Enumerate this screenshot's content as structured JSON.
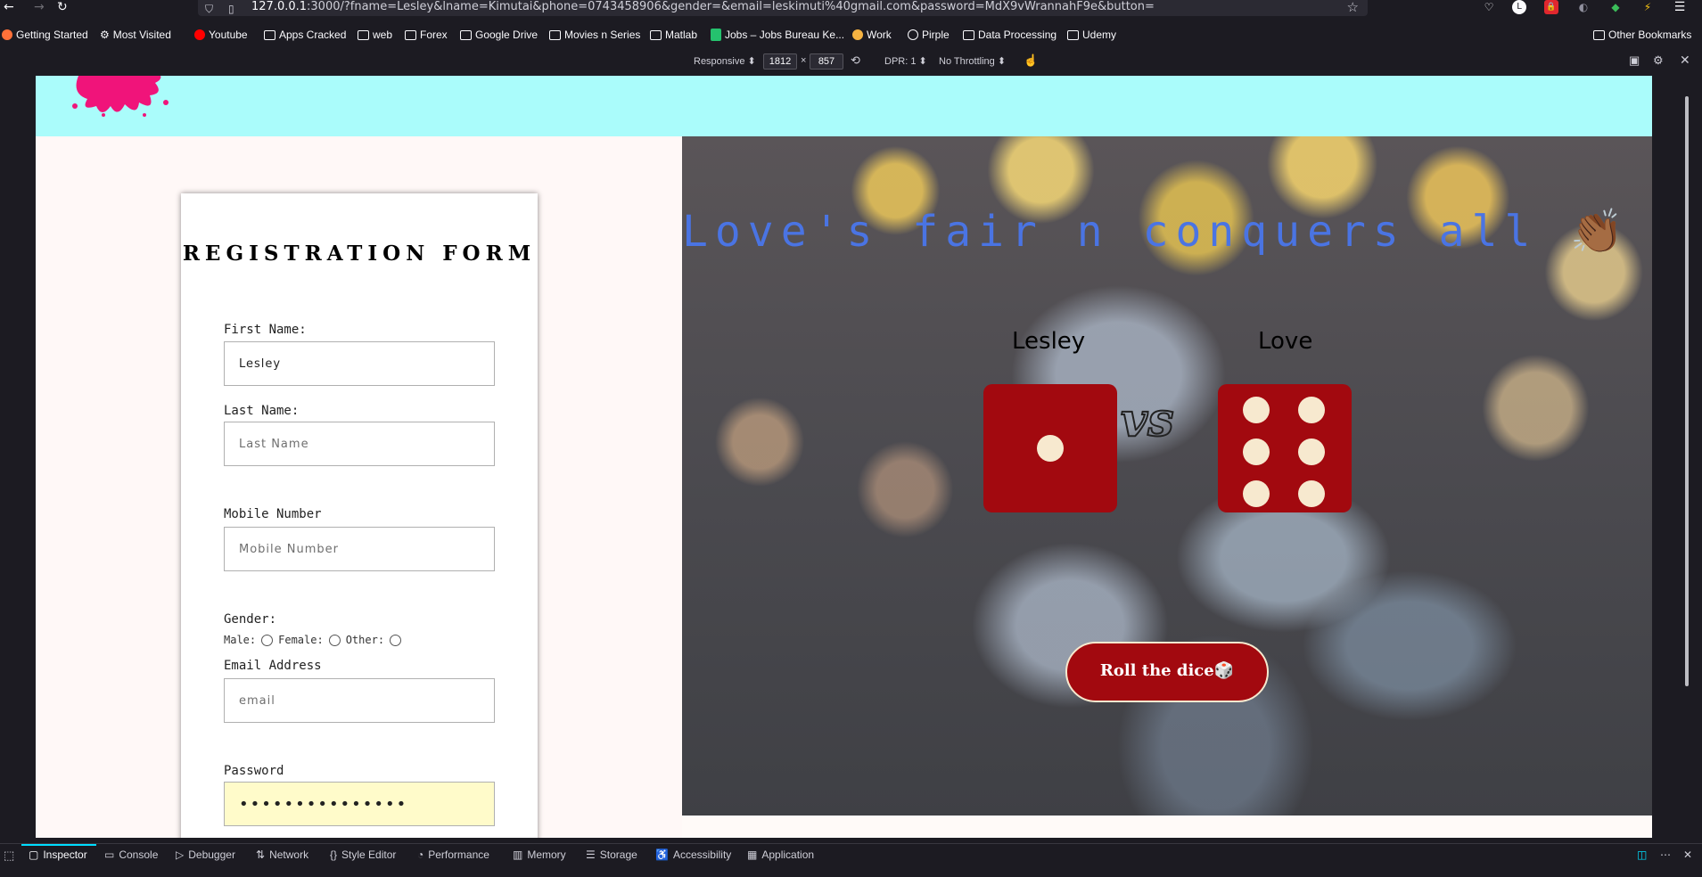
{
  "browser": {
    "url_host": "127.0.0.1",
    "url_rest": ":3000/?fname=Lesley&lname=Kimutai&phone=0743458906&gender=&email=leskimuti%40gmail.com&password=MdX9vWrannahF9e&button=",
    "icons": [
      "back-icon",
      "forward-icon",
      "reload-icon",
      "shield-icon",
      "page-icon",
      "star-icon",
      "pocket-icon",
      "account-icon",
      "extension-icon",
      "menu-icon"
    ]
  },
  "bookmarks": [
    {
      "label": "Getting Started",
      "icon": "firefox-icon"
    },
    {
      "label": "Most Visited",
      "icon": "gear-icon"
    },
    {
      "label": "Youtube",
      "icon": "youtube-icon"
    },
    {
      "label": "Apps Cracked",
      "icon": "folder-icon"
    },
    {
      "label": "web",
      "icon": "folder-icon"
    },
    {
      "label": "Forex",
      "icon": "folder-icon"
    },
    {
      "label": "Google Drive",
      "icon": "folder-icon"
    },
    {
      "label": "Movies n Series",
      "icon": "folder-icon"
    },
    {
      "label": "Matlab",
      "icon": "folder-icon"
    },
    {
      "label": "Jobs – Jobs Bureau Ke...",
      "icon": "jobs-icon"
    },
    {
      "label": "Work",
      "icon": "work-icon"
    },
    {
      "label": "Pirple",
      "icon": "globe-icon"
    },
    {
      "label": "Data Processing",
      "icon": "folder-icon"
    },
    {
      "label": "Udemy",
      "icon": "folder-icon"
    },
    {
      "label": "Other Bookmarks",
      "icon": "folder-icon"
    }
  ],
  "rdm": {
    "device": "Responsive ⬍",
    "width": "1812",
    "times": "×",
    "height": "857",
    "dpr": "DPR: 1 ⬍",
    "throttle": "No Throttling ⬍"
  },
  "form": {
    "title": "Registration Form",
    "first_name_label": "First Name:",
    "first_name_value": "Lesley",
    "last_name_label": "Last Name:",
    "last_name_placeholder": "Last Name",
    "mobile_label": "Mobile Number",
    "mobile_placeholder": "Mobile Number",
    "gender_label": "Gender:",
    "gender_male": "Male:",
    "gender_female": "Female:",
    "gender_other": "Other:",
    "email_label": "Email Address",
    "email_placeholder": "email",
    "password_label": "Password",
    "password_value": "•••••••••••••••"
  },
  "game": {
    "result_text": "Love's fair n conquers all 👏🏾 Its a draw",
    "player1": "Lesley",
    "player2": "Love",
    "player1_die": 1,
    "player2_die": 6,
    "vs": "vs",
    "roll_button": "Roll the dice🎲"
  },
  "devtools": {
    "tabs": [
      {
        "label": "Inspector",
        "icon": "inspector-icon",
        "active": true
      },
      {
        "label": "Console",
        "icon": "console-icon"
      },
      {
        "label": "Debugger",
        "icon": "debugger-icon"
      },
      {
        "label": "Network",
        "icon": "network-icon"
      },
      {
        "label": "Style Editor",
        "icon": "style-editor-icon"
      },
      {
        "label": "Performance",
        "icon": "performance-icon"
      },
      {
        "label": "Memory",
        "icon": "memory-icon"
      },
      {
        "label": "Storage",
        "icon": "storage-icon"
      },
      {
        "label": "Accessibility",
        "icon": "accessibility-icon"
      },
      {
        "label": "Application",
        "icon": "application-icon"
      }
    ]
  },
  "colors": {
    "header_band": "#aafcfb",
    "die_red": "#a2090f",
    "pip": "#f7e9cf",
    "result_text": "#4a74e3",
    "logo_pink": "#f0147a"
  }
}
